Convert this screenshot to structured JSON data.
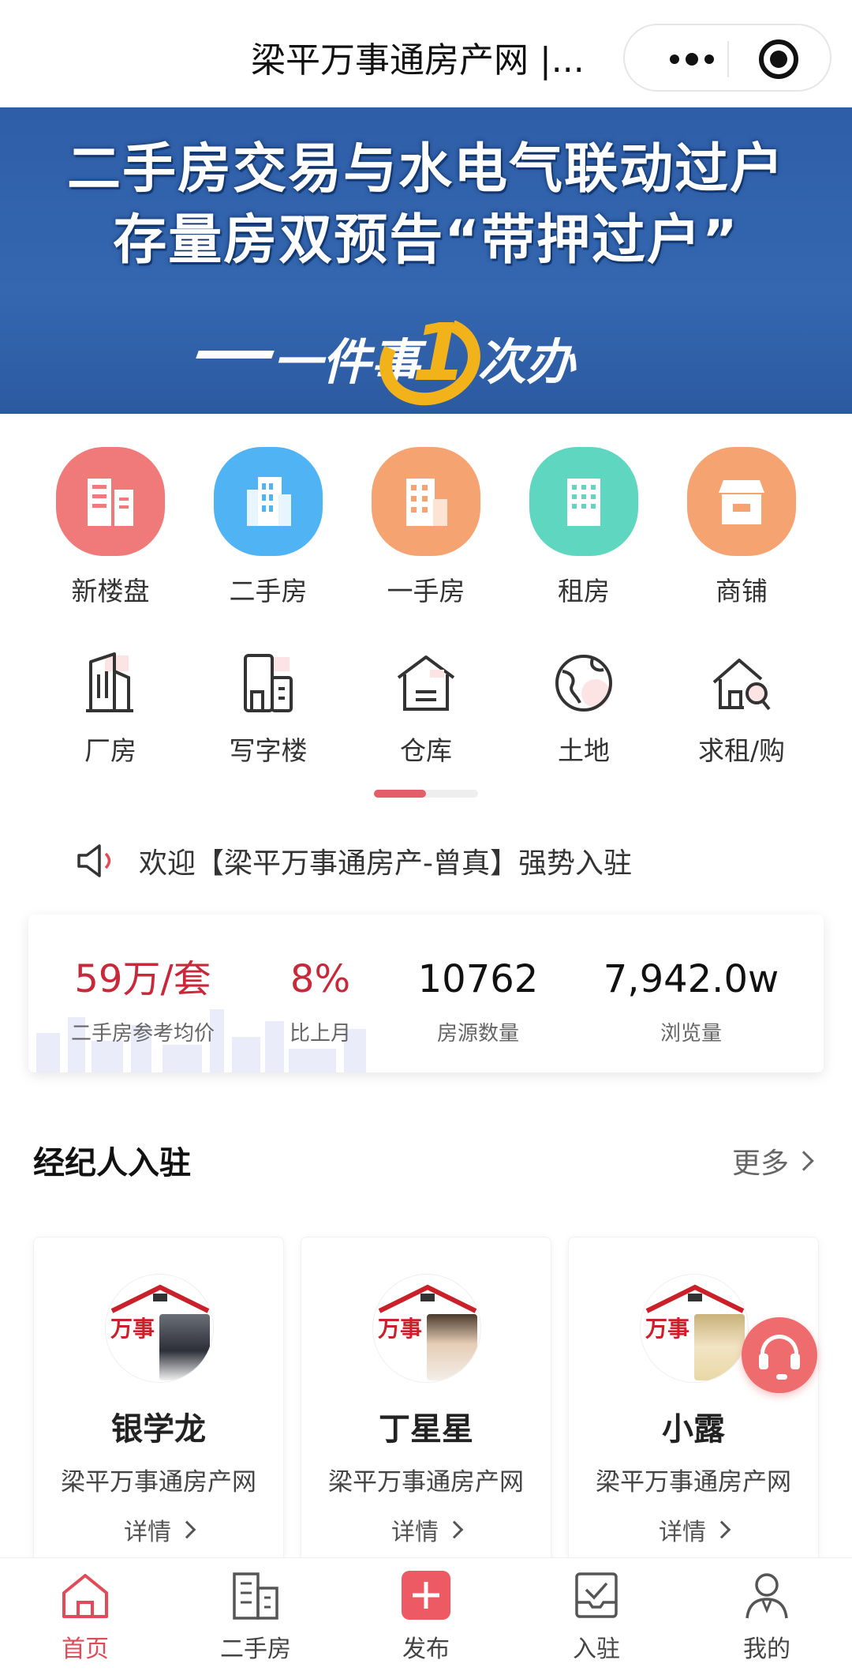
{
  "header": {
    "title": "梁平万事通房产网 |..."
  },
  "banner": {
    "line1": "二手房交易与水电气联动过户",
    "line2": "存量房双预告“带押过户”",
    "slogan_left": "一件事",
    "slogan_one": "1",
    "slogan_right": "次办"
  },
  "categories_row1": [
    {
      "label": "新楼盘",
      "icon": "building-icon",
      "color": "#f07a7a"
    },
    {
      "label": "二手房",
      "icon": "office-tower-icon",
      "color": "#4fb3f4"
    },
    {
      "label": "一手房",
      "icon": "apartment-icon",
      "color": "#f6a372"
    },
    {
      "label": "租房",
      "icon": "block-building-icon",
      "color": "#5fd6bf"
    },
    {
      "label": "商铺",
      "icon": "shop-icon",
      "color": "#f6a372"
    }
  ],
  "categories_row2": [
    {
      "label": "厂房",
      "icon": "factory-icon"
    },
    {
      "label": "写字楼",
      "icon": "office-building-icon"
    },
    {
      "label": "仓库",
      "icon": "warehouse-icon"
    },
    {
      "label": "土地",
      "icon": "globe-land-icon"
    },
    {
      "label": "求租/购",
      "icon": "house-search-icon"
    }
  ],
  "notice": {
    "text": "欢迎【梁平万事通房产-曾真】强势入驻"
  },
  "stats": [
    {
      "value": "59万/套",
      "caption": "二手房参考均价",
      "color": "#c9283b"
    },
    {
      "value": "8%",
      "caption": "比上月",
      "color": "#c9283b"
    },
    {
      "value": "10762",
      "caption": "房源数量",
      "color": "#111111"
    },
    {
      "value": "7,942.0w",
      "caption": "浏览量",
      "color": "#111111"
    }
  ],
  "agents_section": {
    "title": "经纪人入驻",
    "more": "更多"
  },
  "agents": [
    {
      "name": "银学龙",
      "org": "梁平万事通房产网",
      "detail": "详情",
      "logo": "万事",
      "photo_color": "#2c2f38"
    },
    {
      "name": "丁星星",
      "org": "梁平万事通房产网",
      "detail": "详情",
      "logo": "万事",
      "photo_color": "#d9c7b3"
    },
    {
      "name": "小露",
      "org": "梁平万事通房产网",
      "detail": "详情",
      "logo": "万事",
      "photo_color": "#e9d8a6"
    }
  ],
  "tabbar": [
    {
      "label": "首页",
      "icon": "home-icon",
      "active": true
    },
    {
      "label": "二手房",
      "icon": "building-icon",
      "active": false
    },
    {
      "label": "发布",
      "icon": "plus-icon",
      "active": false
    },
    {
      "label": "入驻",
      "icon": "inbox-check-icon",
      "active": false
    },
    {
      "label": "我的",
      "icon": "user-icon",
      "active": false
    }
  ],
  "colors": {
    "accent": "#e24a57",
    "banner_bg": "#2f5ea8",
    "slogan_gold": "#f2b21a"
  }
}
